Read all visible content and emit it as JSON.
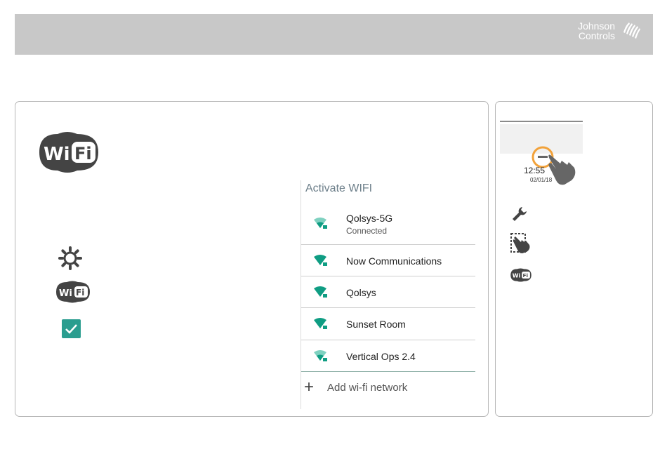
{
  "brand": {
    "line1": "Johnson",
    "line2": "Controls"
  },
  "left_panel": {
    "big_icon": "wifi-logo-icon",
    "steps_icons": [
      "gear-icon",
      "wifi-logo-icon",
      "checkbox-checked-icon"
    ],
    "network_list": {
      "title": "Activate WIFI",
      "networks": [
        {
          "name": "Qolsys-5G",
          "status": "Connected"
        },
        {
          "name": "Now Communications",
          "status": ""
        },
        {
          "name": "Qolsys",
          "status": ""
        },
        {
          "name": "Sunset Room",
          "status": ""
        },
        {
          "name": "Vertical Ops 2.4",
          "status": ""
        }
      ],
      "add_label": "Add wi-fi network"
    }
  },
  "right_panel": {
    "time": "12:55",
    "date": "02/01/18",
    "icons": [
      "wrench-icon",
      "touch-gesture-icon",
      "wifi-logo-icon"
    ]
  },
  "colors": {
    "header_bg": "#c8c8c8",
    "accent_teal": "#0f9d83",
    "highlight_orange": "#f2a23a"
  }
}
